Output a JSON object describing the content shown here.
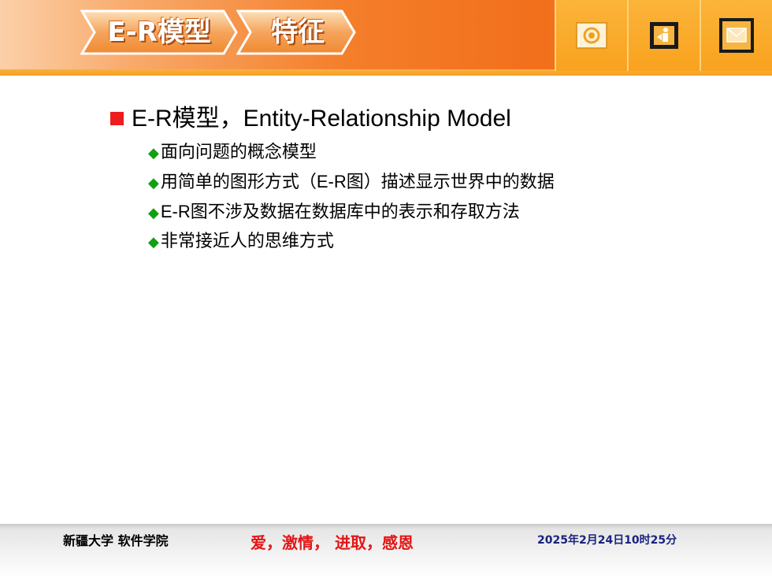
{
  "header": {
    "tabs": [
      {
        "label": "E-R模型"
      },
      {
        "label": "特征"
      }
    ],
    "icons": [
      {
        "name": "target-icon"
      },
      {
        "name": "exit-icon"
      },
      {
        "name": "mail-icon"
      }
    ]
  },
  "content": {
    "heading": "E-R模型，Entity-Relationship Model",
    "bullets": [
      "面向问题的概念模型",
      "用简单的图形方式（E-R图）描述显示世界中的数据",
      "E-R图不涉及数据在数据库中的表示和存取方法",
      "非常接近人的思维方式"
    ]
  },
  "footer": {
    "school": "新疆大学 软件学院",
    "motto": "爱，激情， 进取，感恩",
    "datetime": "2025年2月24日10时25分"
  },
  "colors": {
    "header_orange": "#f47e2a",
    "icon_bar": "#f9a21e",
    "bullet_square": "#ee1c1c",
    "bullet_diamond": "#11a011",
    "motto": "#e31515",
    "date": "#1a237e"
  }
}
